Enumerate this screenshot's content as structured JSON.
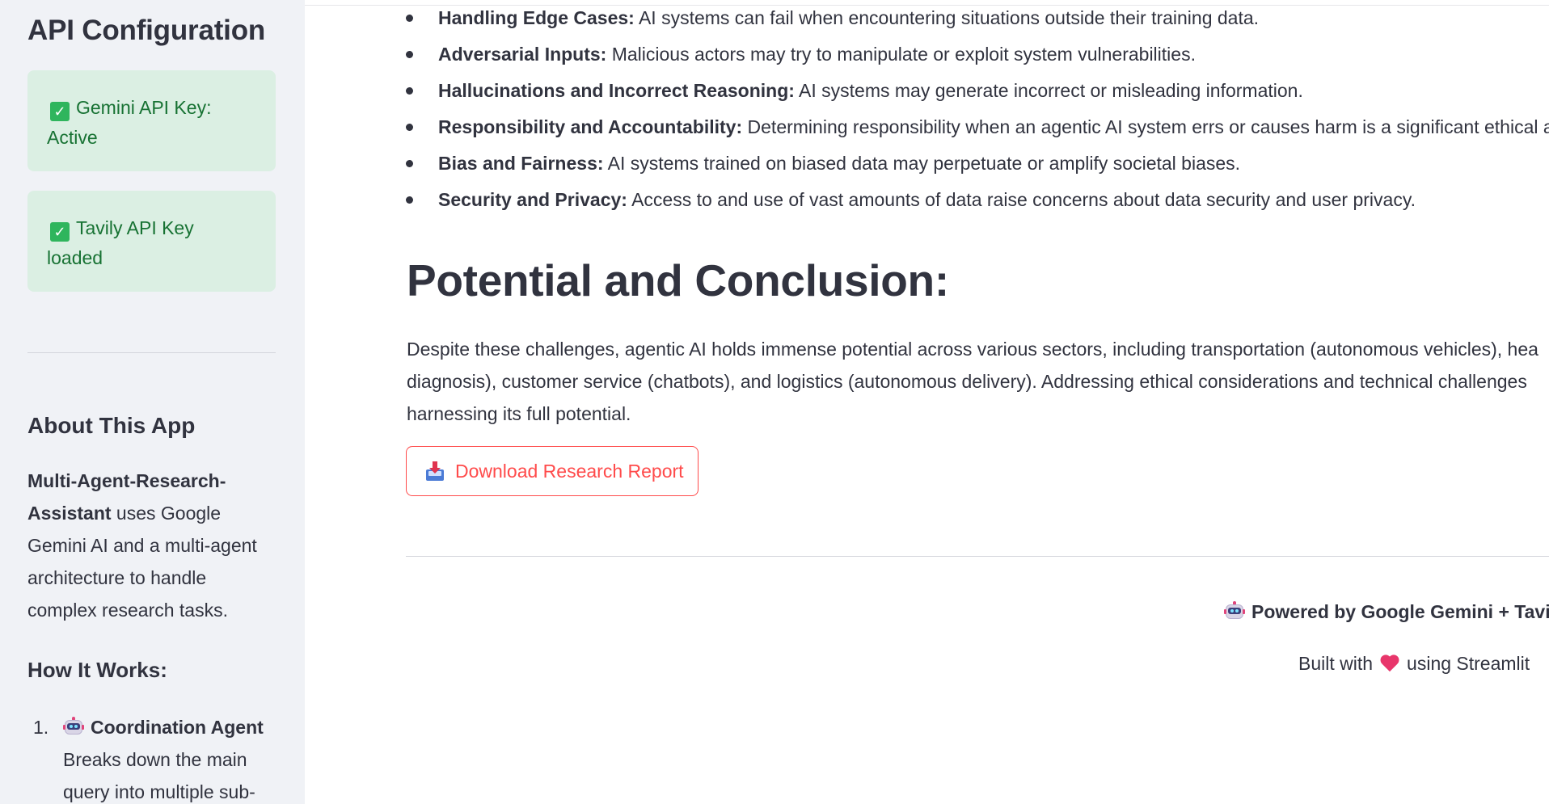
{
  "sidebar": {
    "title": "API Configuration",
    "status": [
      {
        "icon": "check-mark-icon",
        "line1": "Gemini API Key:",
        "line2": "Active"
      },
      {
        "icon": "check-mark-icon",
        "line1": "Tavily API Key",
        "line2": "loaded"
      }
    ],
    "about": {
      "title": "About This App",
      "app_name_line1": "Multi-Agent-Research-",
      "app_name_line2": "Assistant",
      "text_line2_rest": " uses Google",
      "text_line3": "Gemini AI and a multi-agent",
      "text_line4": "architecture to handle",
      "text_line5": "complex research tasks."
    },
    "how": {
      "title": "How It Works:",
      "steps": [
        {
          "number": "1.",
          "icon": "robot-icon",
          "name": "Coordination Agent",
          "desc_line1": "Breaks down the main",
          "desc_line2": "query into multiple sub-"
        }
      ]
    }
  },
  "main": {
    "bullets": [
      {
        "bold": "Handling Edge Cases:",
        "text": " AI systems can fail when encountering situations outside their training data."
      },
      {
        "bold": "Adversarial Inputs:",
        "text": " Malicious actors may try to manipulate or exploit system vulnerabilities."
      },
      {
        "bold": "Hallucinations and Incorrect Reasoning:",
        "text": " AI systems may generate incorrect or misleading information."
      },
      {
        "bold": "Responsibility and Accountability:",
        "text": " Determining responsibility when an agentic AI system errs or causes harm is a significant ethical a"
      },
      {
        "bold": "Bias and Fairness:",
        "text": " AI systems trained on biased data may perpetuate or amplify societal biases."
      },
      {
        "bold": "Security and Privacy:",
        "text": " Access to and use of vast amounts of data raise concerns about data security and user privacy."
      }
    ],
    "section_title": "Potential and Conclusion:",
    "paragraph_lines": [
      "Despite these challenges, agentic AI holds immense potential across various sectors, including transportation (autonomous vehicles), hea",
      "diagnosis), customer service (chatbots), and logistics (autonomous delivery). Addressing ethical considerations and technical challenges",
      "harnessing its full potential."
    ],
    "download_button": {
      "icon": "inbox-tray-icon",
      "label": "Download Research Report"
    }
  },
  "footer": {
    "powered_icon": "robot-icon",
    "powered_text": "Powered by Google Gemini + Tavily Search",
    "built_prefix": "Built with",
    "heart_icon": "heart-icon",
    "built_suffix": "using Streamlit"
  },
  "colors": {
    "sidebar_bg": "#f0f2f6",
    "success_bg": "#dbefe3",
    "success_text": "#177233",
    "primary": "#ff4b4b",
    "text": "#31333f"
  }
}
